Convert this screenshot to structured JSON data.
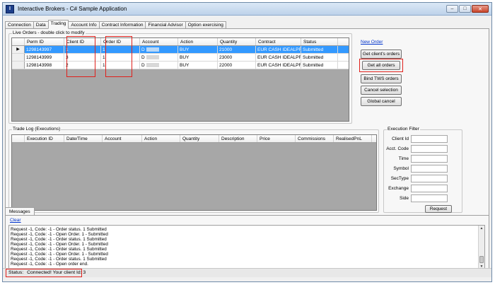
{
  "window": {
    "title": "Interactive Brokers - C# Sample Application",
    "icon_letter": "I"
  },
  "tabs": [
    {
      "label": "Connection"
    },
    {
      "label": "Data"
    },
    {
      "label": "Trading",
      "active": true
    },
    {
      "label": "Account Info"
    },
    {
      "label": "Contract Information"
    },
    {
      "label": "Financial Advisor"
    },
    {
      "label": "Option exercising"
    }
  ],
  "live_orders": {
    "group_label": "Live Orders - double click to modify",
    "columns": [
      "Perm ID",
      "Client ID",
      "Order ID",
      "Account",
      "Action",
      "Quantity",
      "Contract",
      "Status"
    ],
    "rows": [
      {
        "perm_id": "1298143997",
        "client_id": "1",
        "order_id": "1",
        "account": "D",
        "action": "BUY",
        "quantity": "21000",
        "contract": "EUR CASH IDEALPRO",
        "status": "Submitted"
      },
      {
        "perm_id": "1298143999",
        "client_id": "3",
        "order_id": "1",
        "account": "D",
        "action": "BUY",
        "quantity": "23000",
        "contract": "EUR CASH IDEALPRO",
        "status": "Submitted"
      },
      {
        "perm_id": "1298143998",
        "client_id": "2",
        "order_id": "1",
        "account": "D",
        "action": "BUY",
        "quantity": "22000",
        "contract": "EUR CASH IDEALPRO",
        "status": "Submitted"
      }
    ],
    "row_marker": "▶"
  },
  "actions": {
    "new_order": "New Order",
    "get_clients_orders": "Get client's orders",
    "get_all_orders": "Get all orders",
    "bind_tws_orders": "Bind TWS orders",
    "cancel_selection": "Cancel selection",
    "global_cancel": "Global cancel"
  },
  "trade_log": {
    "group_label": "Trade Log (Executions)",
    "columns": [
      "Execution ID",
      "Date/Time",
      "Account",
      "Action",
      "Quantity",
      "Description",
      "Price",
      "Commissions",
      "RealisedPnL"
    ]
  },
  "execution_filter": {
    "group_label": "Execution Filter",
    "fields": [
      "Client Id",
      "Acct. Code",
      "Time",
      "Symbol",
      "SecType",
      "Exchange",
      "Side"
    ],
    "request_button": "Request"
  },
  "messages": {
    "tab_label": "Messages",
    "clear_link": "Clear",
    "lines": [
      "Request -1, Code: -1 - Order status. 1 Submitted",
      "Request -1, Code: -1 - Open Order. 1 - Submitted",
      "Request -1, Code: -1 - Order status. 1 Submitted",
      "Request -1, Code: -1 - Open Order. 1 - Submitted",
      "Request -1, Code: -1 - Order status. 1 Submitted",
      "Request -1, Code: -1 - Open Order. 1 - Submitted",
      "Request -1, Code: -1 - Order status. 1 Submitted",
      "Request -1, Code: -1 - Open order end."
    ]
  },
  "status": {
    "label": "Status:",
    "text": "Connected! Your client Id: 3"
  },
  "colors": {
    "selection": "#3399ff",
    "highlight_box": "#e0201b",
    "link": "#0033cc"
  }
}
